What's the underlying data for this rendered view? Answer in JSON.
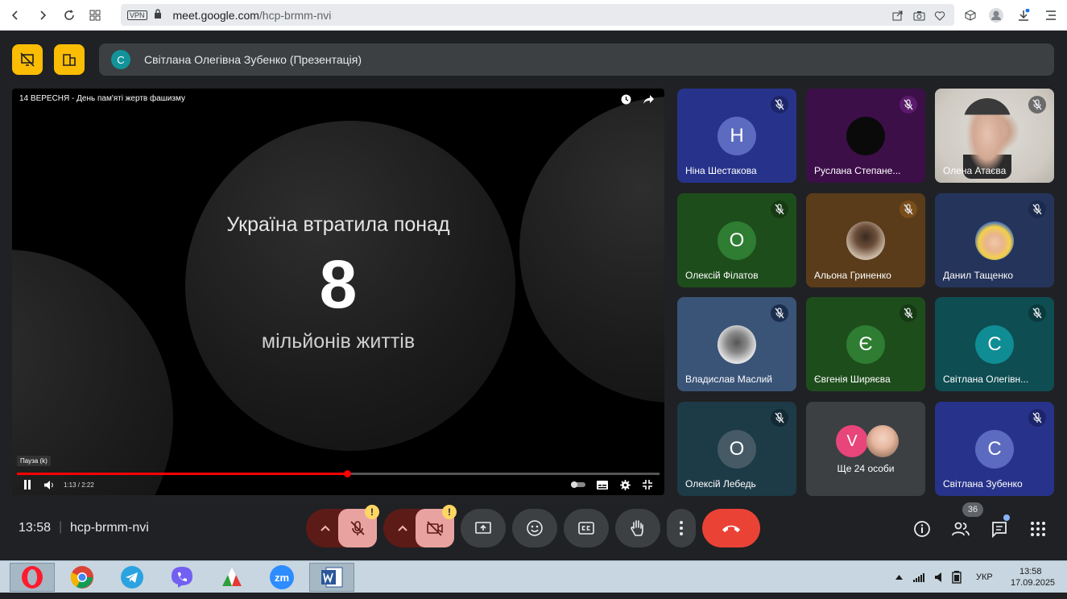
{
  "browser": {
    "vpn_label": "VPN",
    "url_host": "meet.google.com",
    "url_path": "/hcp-brmm-nvi"
  },
  "presenter": {
    "avatar_letter": "С",
    "name": "Світлана Олегівна Зубенко (Презентація)"
  },
  "video": {
    "title": "14 ВЕРЕСНЯ - День пам'яті жертв фашизму",
    "slide_line1": "Україна втратила понад",
    "slide_big": "8",
    "slide_line3": "мільйонів життів",
    "tooltip": "Пауза (k)",
    "time": "1:13 / 2:22",
    "progress_fraction": 0.514
  },
  "participants": [
    {
      "name": "Ніна Шестакова",
      "letter": "Н",
      "bg": "#27338a",
      "avatar_bg": "#5c6bc0",
      "mute_bg": "#1c256a"
    },
    {
      "name": "Руслана Степане...",
      "letter": "",
      "bg": "#3d0f49",
      "avatar_bg": "#0a0a0a",
      "mute_bg": "#5b1a6b"
    },
    {
      "name": "Олена Атаєва",
      "letter": "",
      "bg": "#d8d5cf",
      "avatar_bg": "#555",
      "mute_bg": "#6b6b6b"
    },
    {
      "name": "Олексій Філатов",
      "letter": "О",
      "bg": "#1e4d1c",
      "avatar_bg": "#2e7d32",
      "mute_bg": "#163a14"
    },
    {
      "name": "Альона Гриненко",
      "letter": "",
      "bg": "#5a3c1a",
      "avatar_bg": "#b9a48a",
      "mute_bg": "#7a4e1a"
    },
    {
      "name": "Данил Тащенко",
      "letter": "",
      "bg": "#25345a",
      "avatar_bg": "#e0b54a",
      "mute_bg": "#1b2a4d"
    },
    {
      "name": "Владислав Маслий",
      "letter": "",
      "bg": "#3a5478",
      "avatar_bg": "#cfcfcf",
      "mute_bg": "#1c2e4d"
    },
    {
      "name": "Євгенія Ширяєва",
      "letter": "Є",
      "bg": "#1e4d1c",
      "avatar_bg": "#2e7d32",
      "mute_bg": "#163a14"
    },
    {
      "name": "Світлана Олегівн...",
      "letter": "С",
      "bg": "#0e4d52",
      "avatar_bg": "#0f8c94",
      "mute_bg": "#0a3a3e"
    },
    {
      "name": "Олексій Лебедь",
      "letter": "О",
      "bg": "#1d3a47",
      "avatar_bg": "#455a64",
      "mute_bg": "#132a34"
    },
    {
      "name": "Ще 24 особи",
      "letter": "V",
      "bg": "#3c4043",
      "avatar_bg": "#e8457a",
      "mute_bg": ""
    },
    {
      "name": "Світлана Зубенко",
      "letter": "С",
      "bg": "#27338a",
      "avatar_bg": "#5c6bc0",
      "mute_bg": "#1c256a"
    }
  ],
  "bottom": {
    "clock": "13:58",
    "separator": "|",
    "meeting_code": "hcp-brmm-nvi",
    "warn_mark": "!",
    "people_count": "36"
  },
  "taskbar": {
    "zoom_label": "zm",
    "lang": "УКР",
    "time": "13:58",
    "date": "17.09.2025"
  },
  "colors": {
    "end_call": "#ea4335",
    "muted_button": "#e8a3a0",
    "muted_arrow_bg": "#5c1b17",
    "accent_yellow": "#fbbc04"
  }
}
